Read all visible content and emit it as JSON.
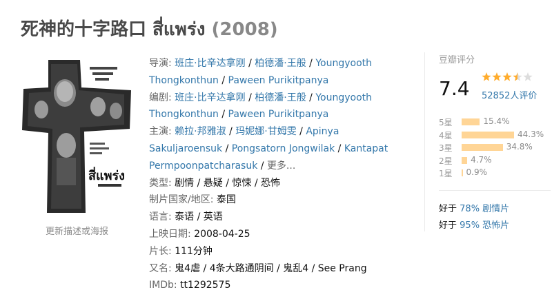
{
  "title": {
    "main": "死神的十字路口 สี่แพร่ง",
    "year": "(2008)"
  },
  "poster": {
    "thai_title": "สี่แพร่ง",
    "update_link": "更新描述或海报"
  },
  "info": {
    "director": {
      "label": "导演",
      "names": [
        "班庄·比辛达拿刚",
        "柏德潘·王般",
        "Youngyooth Thongkonthun",
        "Paween Purikitpanya"
      ]
    },
    "writer": {
      "label": "编剧",
      "names": [
        "班庄·比辛达拿刚",
        "柏德潘·王般",
        "Youngyooth Thongkonthun",
        "Paween Purikitpanya"
      ]
    },
    "cast": {
      "label": "主演",
      "names": [
        "赖拉·邦雅淑",
        "玛妮娜·甘姆雯",
        "Apinya Sakuljaroensuk",
        "Pongsatorn Jongwilak",
        "Kantapat Permpoonpatcharasuk"
      ],
      "more": "更多..."
    },
    "genre": {
      "label": "类型:",
      "values": [
        "剧情",
        "悬疑",
        "惊悚",
        "恐怖"
      ]
    },
    "country": {
      "label": "制片国家/地区:",
      "value": "泰国"
    },
    "language": {
      "label": "语言:",
      "value": "泰语 / 英语"
    },
    "release": {
      "label": "上映日期:",
      "value": "2008-04-25"
    },
    "runtime": {
      "label": "片长:",
      "value": "111分钟"
    },
    "aka": {
      "label": "又名:",
      "value": "鬼4虐 / 4条大路通阴间 / 鬼乱4 / See Prang"
    },
    "imdb": {
      "label": "IMDb:",
      "value": "tt1292575"
    }
  },
  "rating": {
    "label": "豆瓣评分",
    "score": "7.4",
    "stars_value": 3.5,
    "votes": "52852人评价",
    "distribution": [
      {
        "label": "5星",
        "percent": "15.4%",
        "value": 15.4
      },
      {
        "label": "4星",
        "percent": "44.3%",
        "value": 44.3
      },
      {
        "label": "3星",
        "percent": "34.8%",
        "value": 34.8
      },
      {
        "label": "2星",
        "percent": "4.7%",
        "value": 4.7
      },
      {
        "label": "1星",
        "percent": "0.9%",
        "value": 0.9
      }
    ],
    "better_than": [
      {
        "prefix": "好于",
        "link": "78% 剧情片"
      },
      {
        "prefix": "好于",
        "link": "95% 恐怖片"
      }
    ]
  },
  "colors": {
    "link": "#3377aa",
    "star": "#ffac2d",
    "bar": "#ffd596",
    "label_gray": "#666666"
  }
}
